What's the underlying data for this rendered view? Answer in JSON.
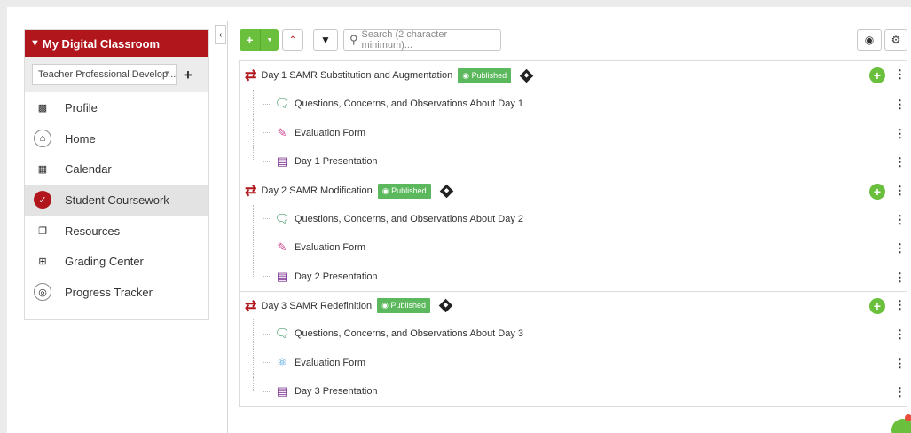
{
  "sidebar": {
    "header_chevron": "⌄",
    "title": "My Digital Classroom",
    "course_select": "Teacher Professional Develop...",
    "add_label": "+",
    "items": [
      {
        "label": "Profile",
        "icon": "profile-card-icon"
      },
      {
        "label": "Home",
        "icon": "home-icon"
      },
      {
        "label": "Calendar",
        "icon": "calendar-icon"
      },
      {
        "label": "Student Coursework",
        "icon": "clipboard-icon",
        "active": true
      },
      {
        "label": "Resources",
        "icon": "resources-icon"
      },
      {
        "label": "Grading Center",
        "icon": "grid-icon"
      },
      {
        "label": "Progress Tracker",
        "icon": "progress-icon"
      }
    ]
  },
  "toolbar": {
    "add_label": "+",
    "search_placeholder": "Search (2 character minimum)..."
  },
  "accent_color": "#b0161c",
  "green_color": "#6abf3c",
  "folders": [
    {
      "title": "Day 1 SAMR Substitution and Augmentation",
      "status": "Published",
      "children": [
        {
          "title": "Questions, Concerns, and Observations About Day 1",
          "icon": "discussion-icon"
        },
        {
          "title": "Evaluation Form",
          "icon": "evaluation-icon"
        },
        {
          "title": "Day 1 Presentation",
          "icon": "document-icon"
        }
      ]
    },
    {
      "title": "Day 2 SAMR Modification",
      "status": "Published",
      "children": [
        {
          "title": "Questions, Concerns, and Observations About Day 2",
          "icon": "discussion-icon"
        },
        {
          "title": "Evaluation Form",
          "icon": "evaluation-icon"
        },
        {
          "title": "Day 2 Presentation",
          "icon": "document-icon"
        }
      ]
    },
    {
      "title": "Day 3 SAMR Redefinition",
      "status": "Published",
      "children": [
        {
          "title": "Questions, Concerns, and Observations About Day 3",
          "icon": "discussion-icon"
        },
        {
          "title": "Evaluation Form",
          "icon": "evaluation-alt-icon"
        },
        {
          "title": "Day 3 Presentation",
          "icon": "document-icon"
        }
      ]
    }
  ]
}
